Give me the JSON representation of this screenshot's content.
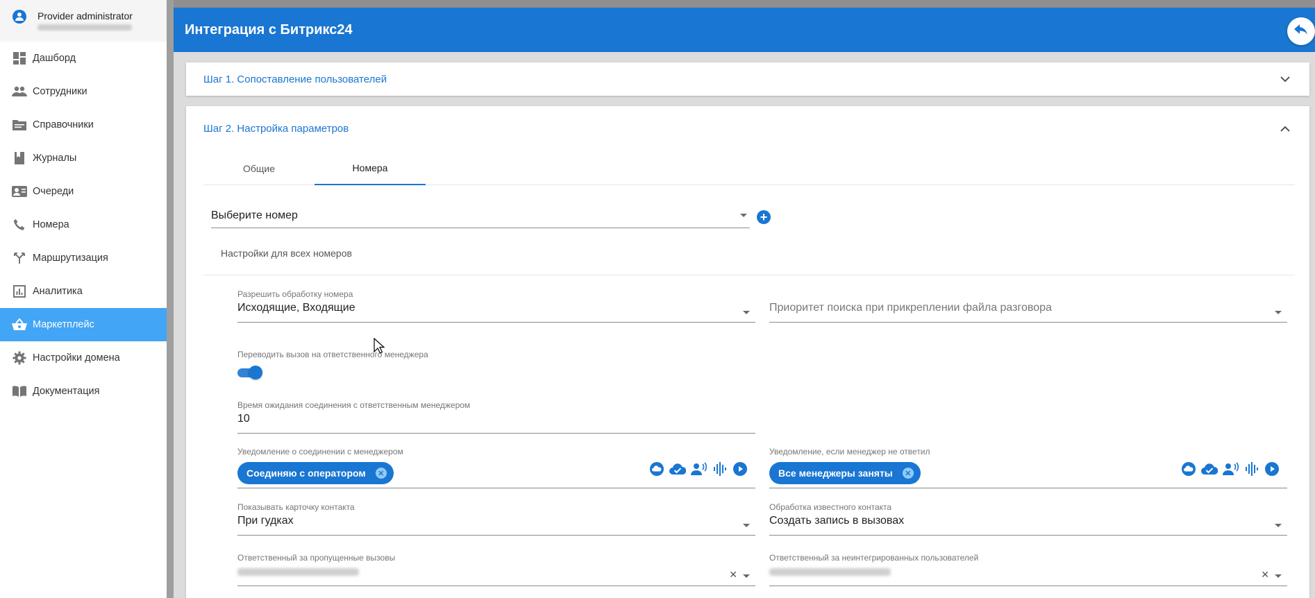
{
  "profile": {
    "role": "Provider administrator"
  },
  "nav": [
    {
      "label": "Дашборд",
      "icon": "dashboard-icon"
    },
    {
      "label": "Сотрудники",
      "icon": "people-icon"
    },
    {
      "label": "Справочники",
      "icon": "folder-icon"
    },
    {
      "label": "Журналы",
      "icon": "book-icon"
    },
    {
      "label": "Очереди",
      "icon": "contact-card-icon"
    },
    {
      "label": "Номера",
      "icon": "phone-icon"
    },
    {
      "label": "Маршрутизация",
      "icon": "routing-icon"
    },
    {
      "label": "Аналитика",
      "icon": "analytics-icon"
    },
    {
      "label": "Маркетплейс",
      "icon": "basket-icon",
      "active": true
    },
    {
      "label": "Настройки домена",
      "icon": "gear-icon"
    },
    {
      "label": "Документация",
      "icon": "documentation-icon"
    }
  ],
  "header": {
    "title": "Интеграция с Битрикс24"
  },
  "step1": {
    "title": "Шаг 1. Сопоставление пользователей"
  },
  "step2": {
    "title": "Шаг 2. Настройка параметров",
    "tabs": [
      {
        "label": "Общие"
      },
      {
        "label": "Номера",
        "active": true
      }
    ],
    "number_select": {
      "value": "Выберите номер"
    },
    "section_label": "Настройки для всех номеров",
    "fields": {
      "allow_processing": {
        "label": "Разрешить обработку номера",
        "value": "Исходящие, Входящие"
      },
      "search_priority": {
        "placeholder": "Приоритет поиска при прикреплении файла разговора"
      },
      "transfer_manager": {
        "label": "Переводить вызов на ответственного менеджера",
        "enabled": true
      },
      "wait_time": {
        "label": "Время ожидания соединения с ответственным менеджером",
        "value": "10"
      },
      "connect_notice": {
        "label": "Уведомление о соединении с менеджером",
        "chip": "Соединяю с оператором"
      },
      "no_answer_notice": {
        "label": "Уведомление, если менеджер не ответил",
        "chip": "Все менеджеры заняты"
      },
      "show_card": {
        "label": "Показывать карточку контакта",
        "value": "При гудках"
      },
      "known_contact": {
        "label": "Обработка известного контакта",
        "value": "Создать запись в вызовах"
      },
      "missed_responsible": {
        "label": "Ответственный за пропущенные вызовы"
      },
      "non_integrated_responsible": {
        "label": "Ответственный за неинтегрированных пользователей"
      }
    }
  },
  "colors": {
    "accent": "#1976d2",
    "active_nav": "#42a5f5"
  }
}
